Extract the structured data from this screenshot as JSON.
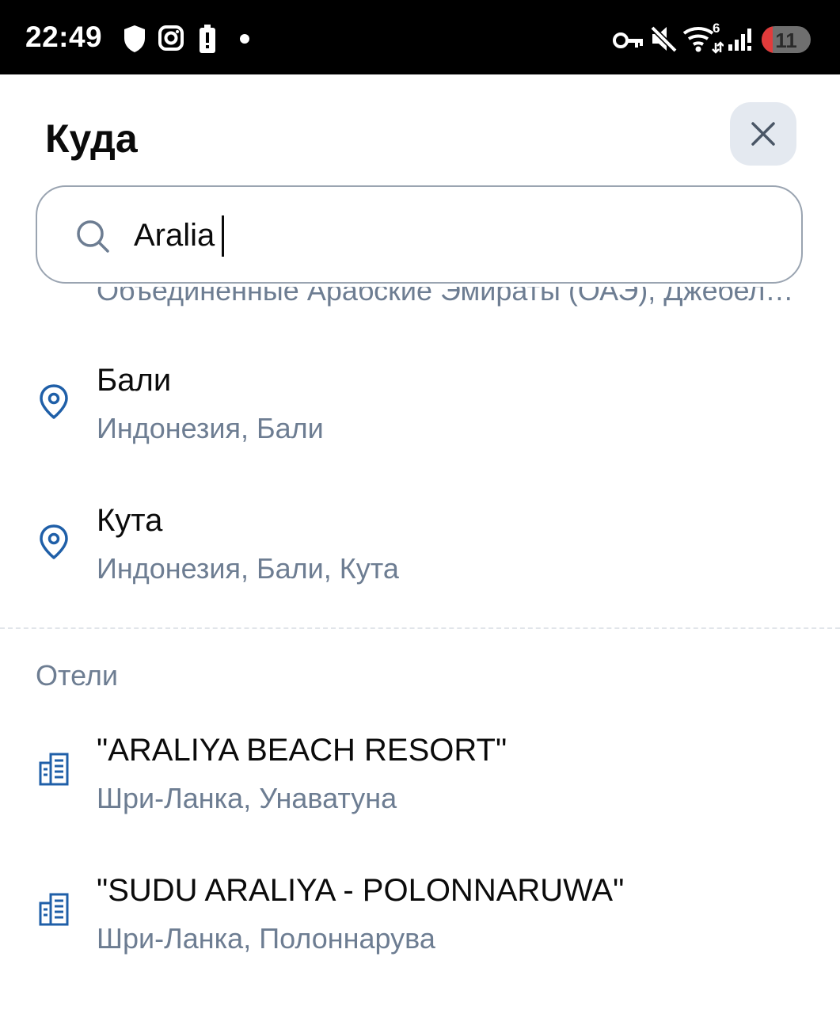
{
  "status_bar": {
    "time": "22:49",
    "icons": [
      "shield-icon",
      "instagram-icon",
      "battery-alert-icon",
      "dot-icon",
      "vpn-key-icon",
      "mute-icon",
      "wifi-icon",
      "signal-icon"
    ],
    "wifi_badge": "6",
    "battery_level": "11",
    "battery_color": "#e23b3b"
  },
  "header": {
    "title": "Куда",
    "close_icon": "close-icon"
  },
  "search": {
    "icon": "search-icon",
    "value": "Aralia"
  },
  "results": {
    "clipped_subtitle": "Объединенные Арабские Эмираты (ОАЭ), Джебель-Али",
    "places": [
      {
        "icon": "location-pin-icon",
        "title": "Бали",
        "subtitle": "Индонезия, Бали"
      },
      {
        "icon": "location-pin-icon",
        "title": "Кута",
        "subtitle": "Индонезия, Бали, Кута"
      }
    ],
    "hotels_section_label": "Отели",
    "hotels": [
      {
        "icon": "hotel-building-icon",
        "title": "\"ARALIYA BEACH RESORT\"",
        "subtitle": "Шри-Ланка, Унаватуна"
      },
      {
        "icon": "hotel-building-icon",
        "title": "\"SUDU ARALIYA - POLONNARUWA\"",
        "subtitle": "Шри-Ланка, Полоннарува"
      }
    ]
  },
  "colors": {
    "accent_blue": "#1f5fa8",
    "muted_text": "#6d7d92",
    "close_bg": "#e4e9f0",
    "border": "#9aa4b1"
  }
}
